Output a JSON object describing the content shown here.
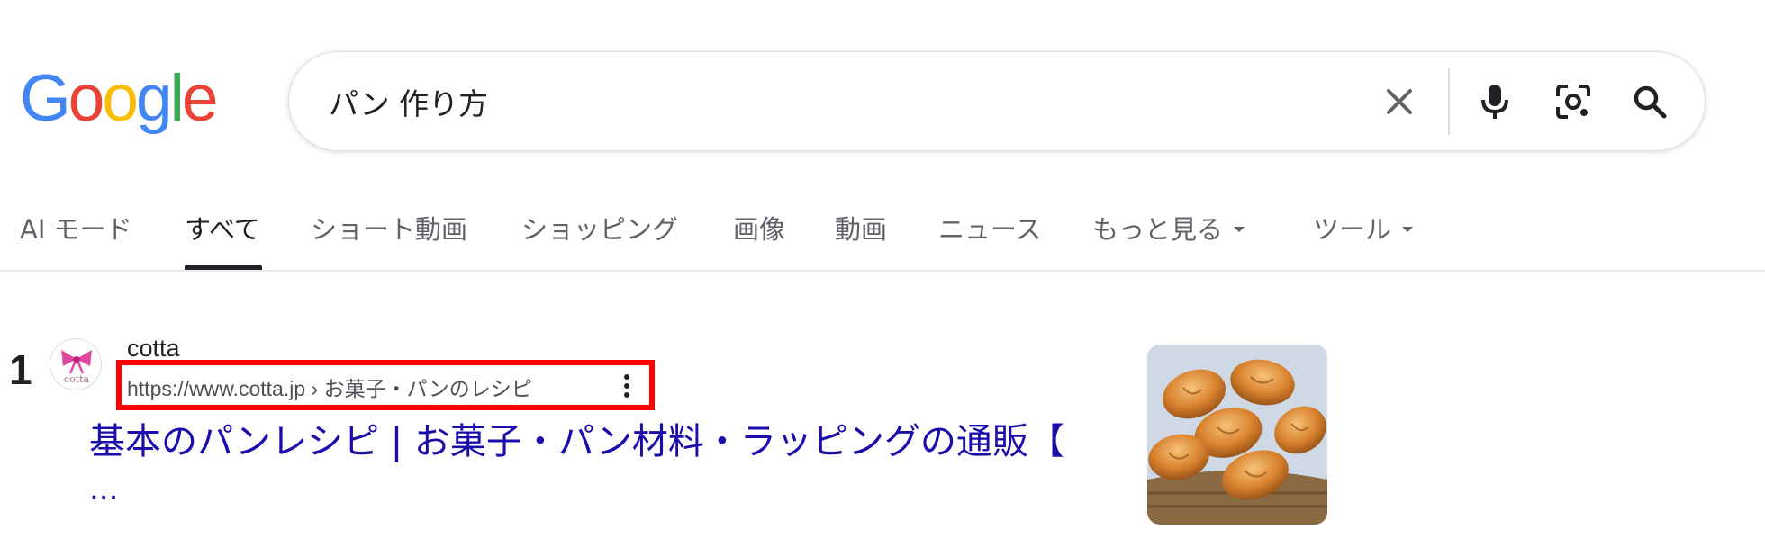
{
  "logo": {
    "letters": [
      "G",
      "o",
      "o",
      "g",
      "l",
      "e"
    ],
    "colors": [
      "#4285F4",
      "#EA4335",
      "#FBBC05",
      "#4285F4",
      "#34A853",
      "#EA4335"
    ]
  },
  "search": {
    "query": "パン 作り方"
  },
  "icons": {
    "clear": "close-icon",
    "mic": "microphone-icon",
    "lens": "camera-lens-icon",
    "search": "search-icon",
    "more": "more-vert-icon"
  },
  "tabs": [
    {
      "label": "AI モード"
    },
    {
      "label": "すべて"
    },
    {
      "label": "ショート動画"
    },
    {
      "label": "ショッピング"
    },
    {
      "label": "画像"
    },
    {
      "label": "動画"
    },
    {
      "label": "ニュース"
    },
    {
      "label": "もっと見る"
    },
    {
      "label": "ツール"
    }
  ],
  "result": {
    "number": "1",
    "site_name": "cotta",
    "favicon_text": "cotta",
    "url": "https://www.cotta.jp › お菓子・パンのレシピ",
    "title": "基本のパンレシピ | お菓子・パン材料・ラッピングの通販【",
    "title_continuation": "..."
  },
  "colors": {
    "link": "#1a0dab",
    "highlight": "#ff0000",
    "active_tab": "#202124",
    "inactive_tab": "#5f6368"
  }
}
